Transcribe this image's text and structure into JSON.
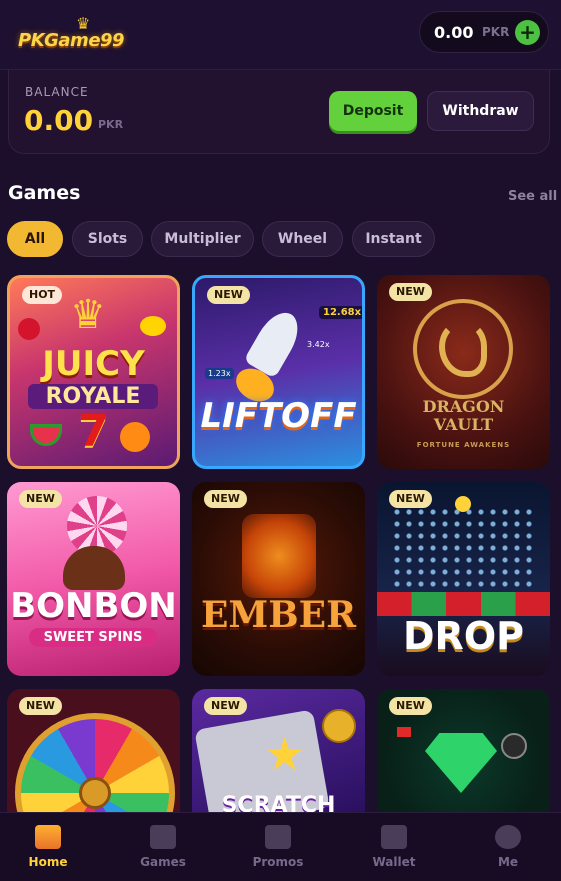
{
  "header": {
    "logo_text": "PKGame99",
    "wallet_amount": "0.00",
    "wallet_currency": "PKR",
    "wallet_plus": "+"
  },
  "balance": {
    "label": "BALANCE",
    "amount": "0.00",
    "currency": "PKR",
    "deposit_label": "Deposit",
    "withdraw_label": "Withdraw"
  },
  "games_section": {
    "title": "Games",
    "see_all": "See all"
  },
  "filters": [
    {
      "label": "All",
      "active": true
    },
    {
      "label": "Slots",
      "active": false
    },
    {
      "label": "Multiplier",
      "active": false
    },
    {
      "label": "Wheel",
      "active": false
    },
    {
      "label": "Instant",
      "active": false
    }
  ],
  "games": [
    {
      "badge": "HOT",
      "title": "JUICY ROYALE",
      "line1": "JUICY",
      "line2": "ROYALE",
      "extra": "7"
    },
    {
      "badge": "NEW",
      "title": "LIFTOFF",
      "line1": "LIFTOFF",
      "mult_high": "12.68x",
      "mult_mid": "3.42x",
      "mult_low": "1.23x"
    },
    {
      "badge": "NEW",
      "title": "DRAGON VAULT",
      "line1": "DRAGON",
      "line2": "VAULT",
      "sub": "FORTUNE AWAKENS"
    },
    {
      "badge": "NEW",
      "title": "BONBON SWEET SPINS",
      "line1": "BONBON",
      "line2": "SWEET SPINS"
    },
    {
      "badge": "NEW",
      "title": "EMBER",
      "line1": "EMBER"
    },
    {
      "badge": "NEW",
      "title": "DROP",
      "line1": "DROP"
    },
    {
      "badge": "NEW",
      "title": "WHEEL"
    },
    {
      "badge": "NEW",
      "title": "SCRATCH",
      "line1": "SCRATCH"
    },
    {
      "badge": "NEW",
      "title": "MINES"
    }
  ],
  "bottom_nav": [
    {
      "label": "Home",
      "icon": "home-icon",
      "active": true
    },
    {
      "label": "Games",
      "icon": "games-icon",
      "active": false
    },
    {
      "label": "Promos",
      "icon": "gift-icon",
      "active": false
    },
    {
      "label": "Wallet",
      "icon": "wallet-icon",
      "active": false
    },
    {
      "label": "Me",
      "icon": "profile-icon",
      "active": false
    }
  ]
}
